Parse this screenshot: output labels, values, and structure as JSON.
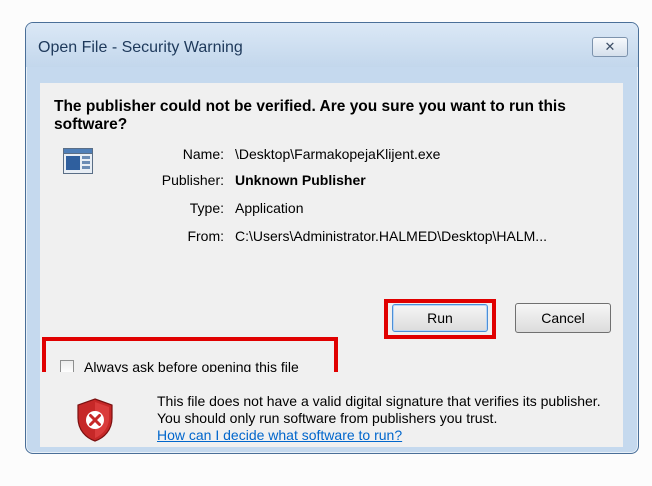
{
  "dialog": {
    "title": "Open File - Security Warning",
    "close_icon": "close-icon"
  },
  "warning": {
    "headline": "The publisher could not be verified.  Are you sure you want to run this software?",
    "app_icon": "application-icon"
  },
  "details": {
    "name_label": "Name:",
    "name_value": "\\Desktop\\FarmakopejaKlijent.exe",
    "publisher_label": "Publisher:",
    "publisher_value": "Unknown Publisher",
    "type_label": "Type:",
    "type_value": "Application",
    "from_label": "From:",
    "from_value": "C:\\Users\\Administrator.HALMED\\Desktop\\HALM..."
  },
  "buttons": {
    "run_label": "Run",
    "cancel_label": "Cancel"
  },
  "checkbox": {
    "label": "Always ask before opening this file",
    "checked": false
  },
  "footer": {
    "shield_icon": "security-shield-icon",
    "message": "This file does not have a valid digital signature that verifies its publisher.  You should only run software from publishers you trust.",
    "link_text": "How can I decide what software to run?"
  },
  "colors": {
    "highlight": "#e00000",
    "link": "#0066cc",
    "titlebar": "#c5d9ee"
  }
}
